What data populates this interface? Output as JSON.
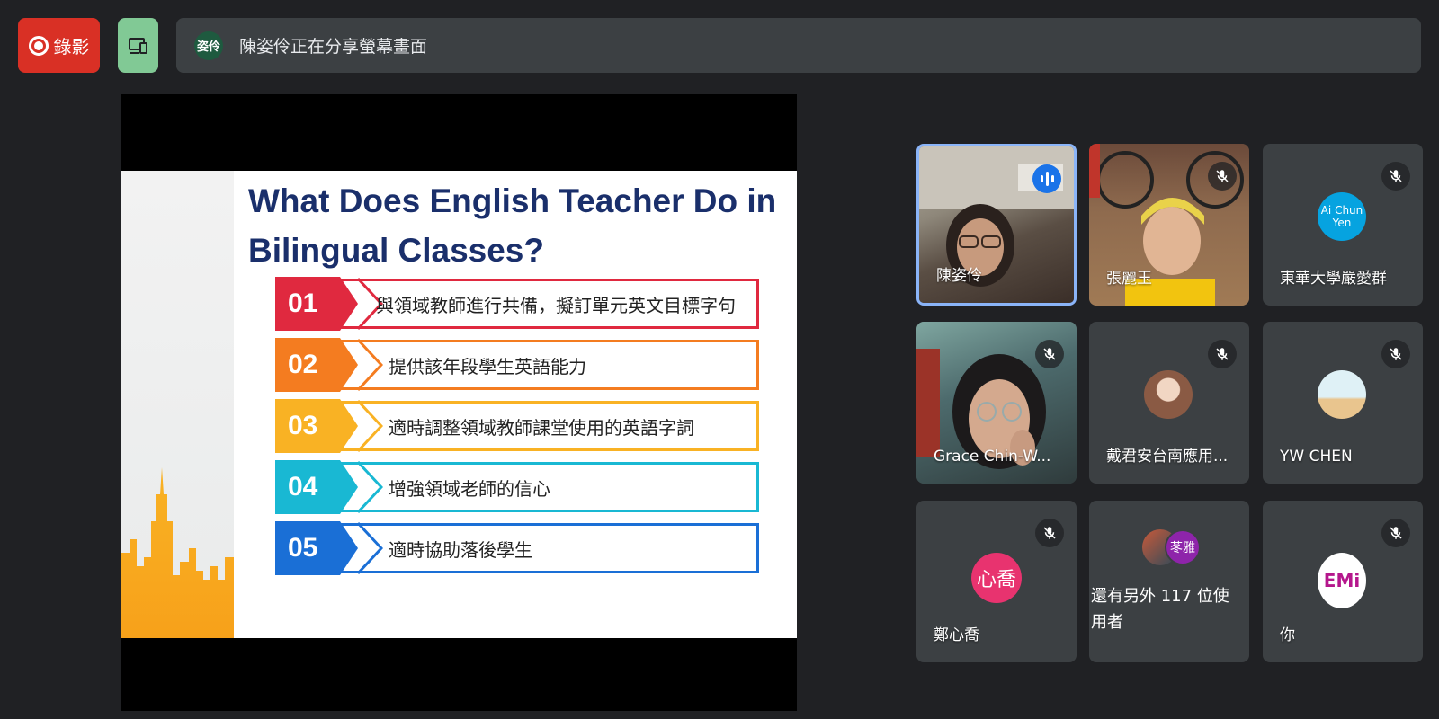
{
  "topbar": {
    "record_label": "錄影",
    "share_avatar": "姿伶",
    "share_text": "陳姿伶正在分享螢幕畫面"
  },
  "slide": {
    "title": "What Does English Teacher Do in Bilingual Classes?",
    "items": [
      {
        "num": "01",
        "text": "與領域教師進行共備，擬訂單元英文目標字句",
        "color": "#e0293f"
      },
      {
        "num": "02",
        "text": "提供該年段學生英語能力",
        "color": "#f47c20"
      },
      {
        "num": "03",
        "text": "適時調整領域教師課堂使用的英語字詞",
        "color": "#f9b224"
      },
      {
        "num": "04",
        "text": "增強領域老師的信心",
        "color": "#19b8d3"
      },
      {
        "num": "05",
        "text": "適時協助落後學生",
        "color": "#1a6fd6"
      }
    ]
  },
  "participants": [
    {
      "name": "陳姿伶"
    },
    {
      "name": "張麗玉"
    },
    {
      "name": "東華大學嚴愛群",
      "avatar_text": "Ai Chun Yen"
    },
    {
      "name": "Grace Chin-W..."
    },
    {
      "name": "戴君安台南應用..."
    },
    {
      "name": "YW CHEN"
    },
    {
      "name": "鄭心喬",
      "avatar_text": "心喬"
    },
    {
      "name": "還有另外 117 位使用者",
      "avatar_text": "苳雅"
    },
    {
      "name": "你",
      "avatar_text": "EMi"
    }
  ],
  "colors": {
    "record": "#d93025",
    "device": "#81c995",
    "speaking": "#1a73e8",
    "active_border": "#8ab4f8"
  }
}
